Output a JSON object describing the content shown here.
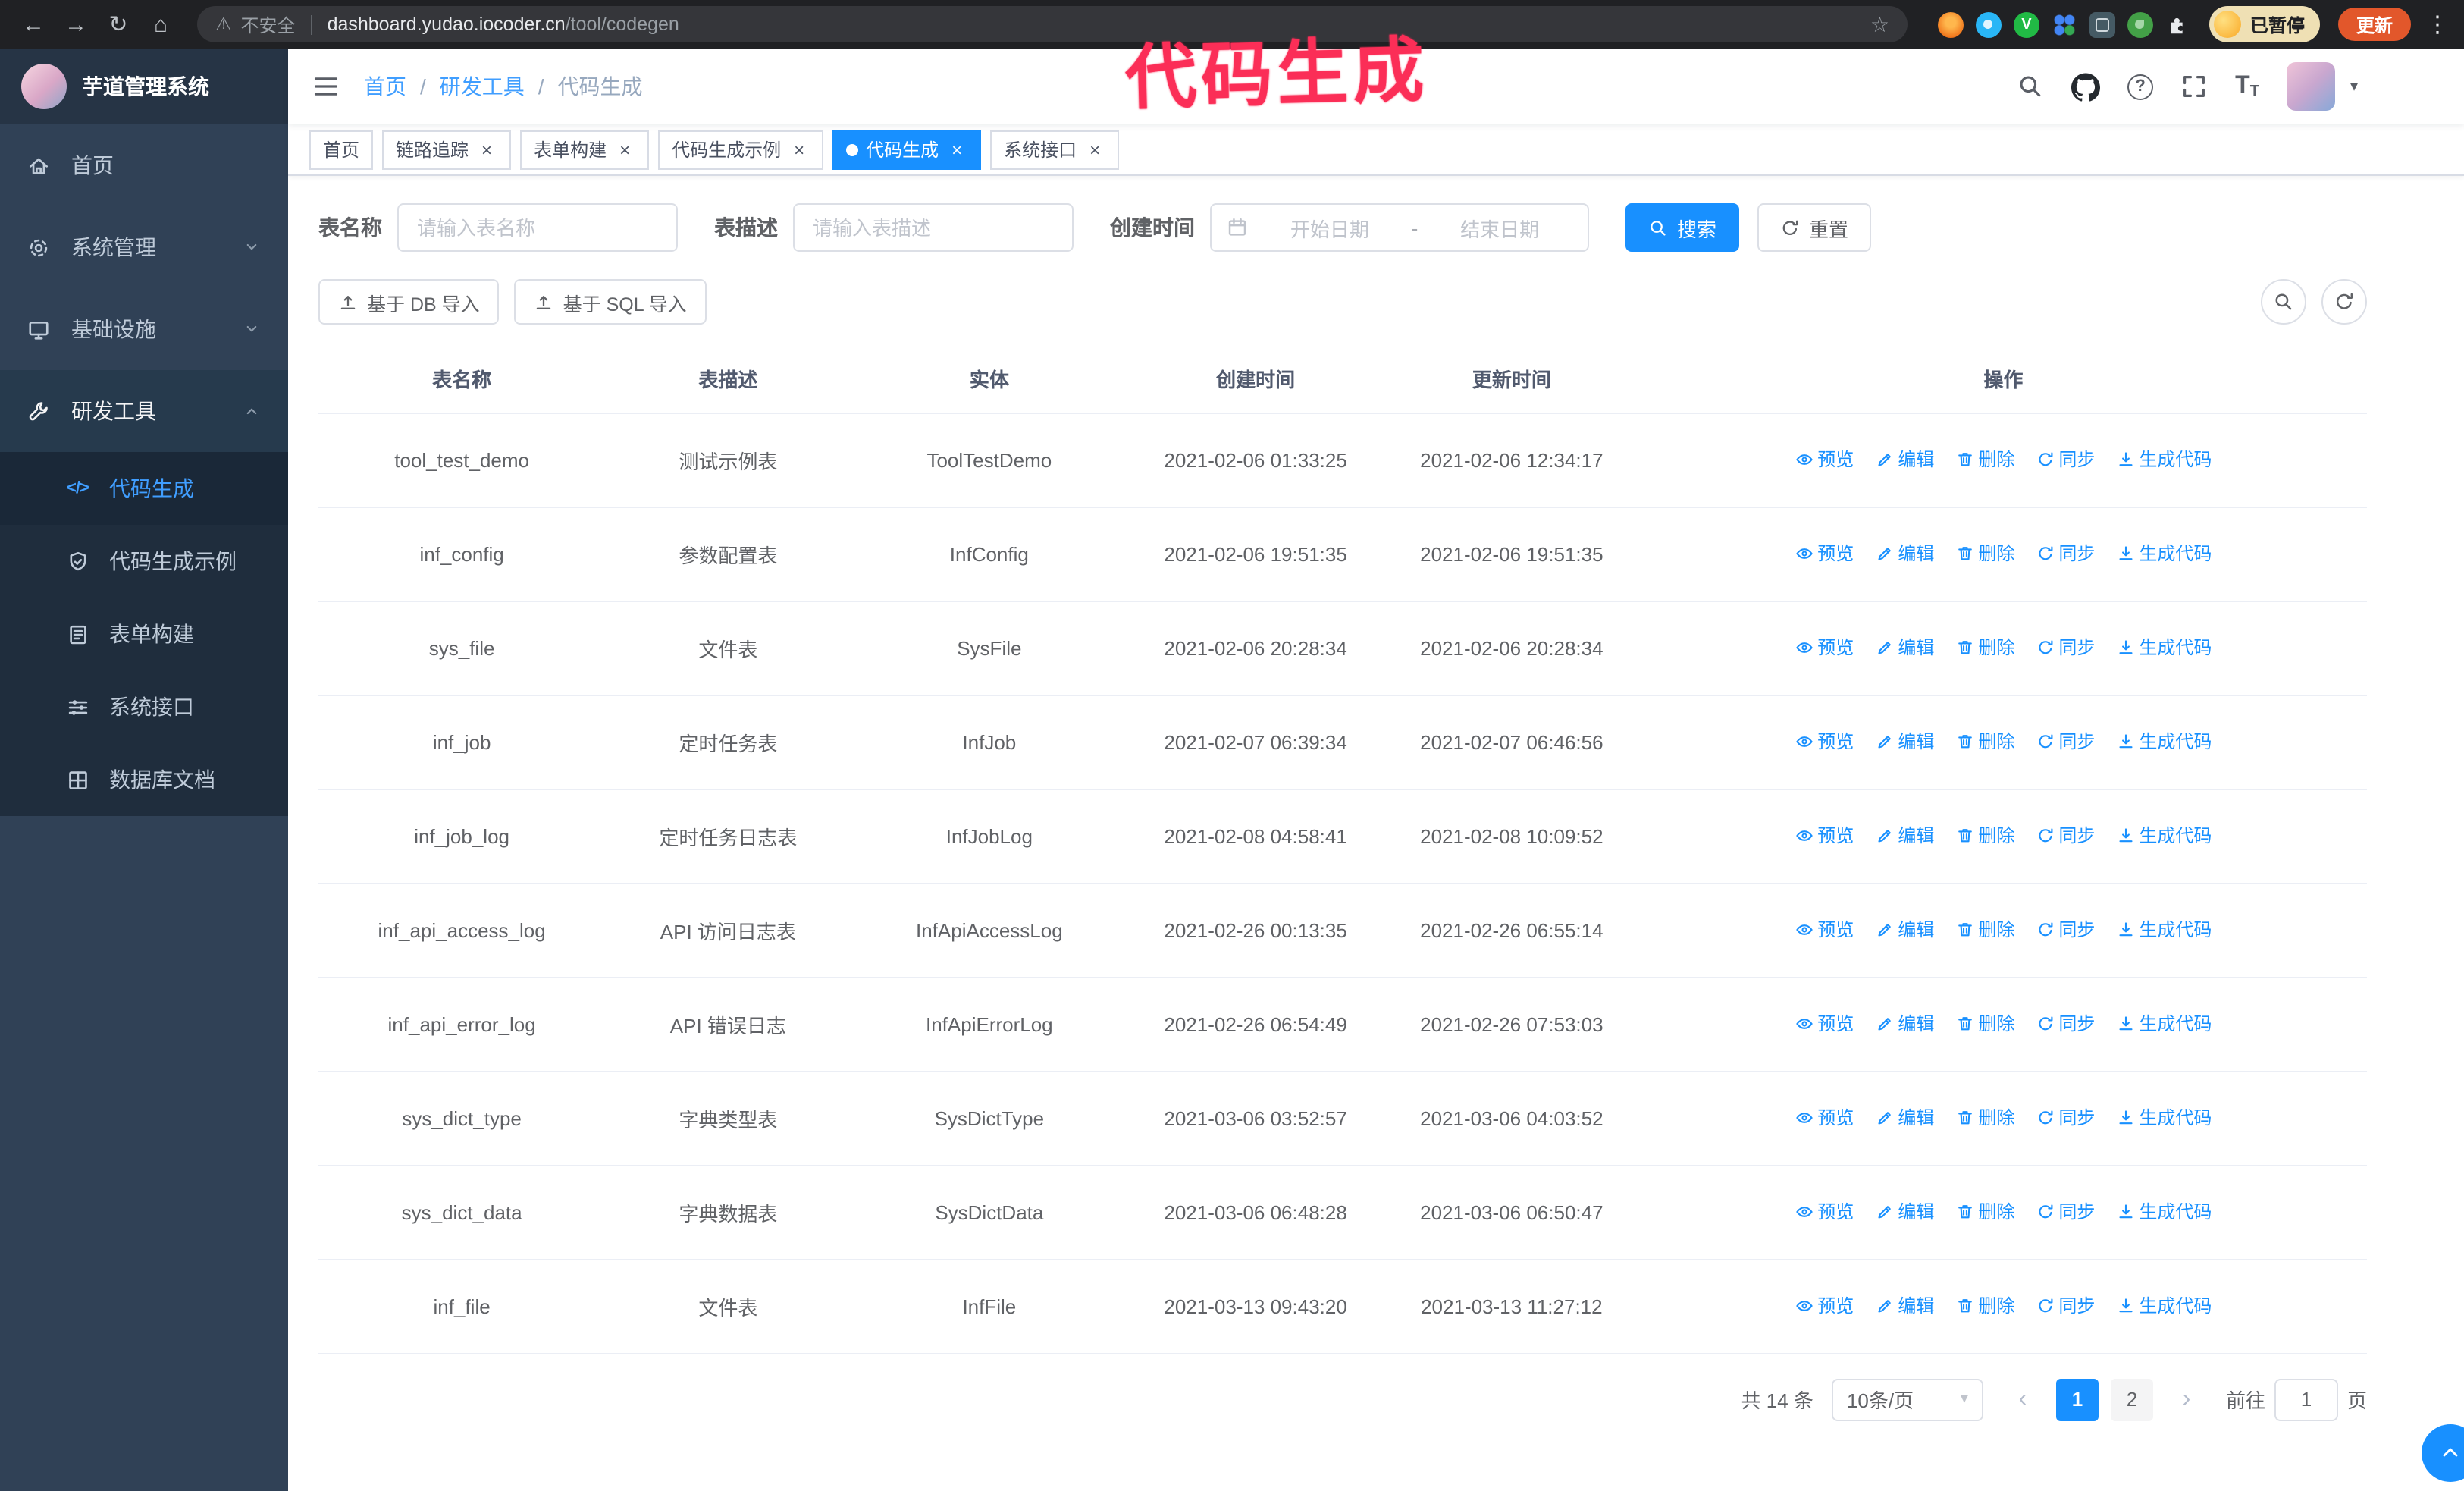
{
  "browser": {
    "security_label": "不安全",
    "url_host": "dashboard.yudao.iocoder.cn",
    "url_path": "/tool/codegen",
    "paused_label": "已暂停",
    "update_label": "更新",
    "nav_icons": [
      "back-icon",
      "forward-icon",
      "reload-icon",
      "home-icon"
    ],
    "right_icons": [
      "bookmark-star-icon",
      "extension-icons",
      "browser-menu-icon"
    ]
  },
  "annotation": {
    "text": "代码生成",
    "color": "#fb2e57"
  },
  "sidebar": {
    "logo_title": "芋道管理系统",
    "items": [
      {
        "label": "首页",
        "icon": "home",
        "expandable": false,
        "expanded": false
      },
      {
        "label": "系统管理",
        "icon": "gear",
        "expandable": true,
        "expanded": false
      },
      {
        "label": "基础设施",
        "icon": "monitor",
        "expandable": true,
        "expanded": false
      },
      {
        "label": "研发工具",
        "icon": "wrench",
        "expandable": true,
        "expanded": true
      }
    ],
    "submenu": [
      {
        "label": "代码生成",
        "icon": "code",
        "active": true
      },
      {
        "label": "代码生成示例",
        "icon": "shield",
        "active": false
      },
      {
        "label": "表单构建",
        "icon": "form",
        "active": false
      },
      {
        "label": "系统接口",
        "icon": "sliders",
        "active": false
      },
      {
        "label": "数据库文档",
        "icon": "grid",
        "active": false
      }
    ]
  },
  "header": {
    "breadcrumb": [
      "首页",
      "研发工具",
      "代码生成"
    ],
    "right_icons": [
      "search-icon",
      "github-icon",
      "help-icon",
      "fullscreen-icon",
      "font-size-icon",
      "avatar",
      "caret-down-icon"
    ]
  },
  "tabs": [
    {
      "label": "首页",
      "closable": false,
      "active": false
    },
    {
      "label": "链路追踪",
      "closable": true,
      "active": false
    },
    {
      "label": "表单构建",
      "closable": true,
      "active": false
    },
    {
      "label": "代码生成示例",
      "closable": true,
      "active": false
    },
    {
      "label": "代码生成",
      "closable": true,
      "active": true
    },
    {
      "label": "系统接口",
      "closable": true,
      "active": false
    }
  ],
  "filters": {
    "table_name_label": "表名称",
    "table_name_placeholder": "请输入表名称",
    "table_desc_label": "表描述",
    "table_desc_placeholder": "请输入表描述",
    "create_time_label": "创建时间",
    "date_start_placeholder": "开始日期",
    "date_separator": "-",
    "date_end_placeholder": "结束日期",
    "search_label": "搜索",
    "reset_label": "重置"
  },
  "toolbar": {
    "import_db_label": "基于 DB 导入",
    "import_sql_label": "基于 SQL 导入",
    "right_icons": [
      "search-icon",
      "refresh-icon"
    ]
  },
  "table": {
    "columns": [
      "表名称",
      "表描述",
      "实体",
      "创建时间",
      "更新时间",
      "操作"
    ],
    "actions": [
      {
        "label": "预览",
        "name": "preview",
        "icon": "eye"
      },
      {
        "label": "编辑",
        "name": "edit",
        "icon": "pencil"
      },
      {
        "label": "删除",
        "name": "delete",
        "icon": "trash"
      },
      {
        "label": "同步",
        "name": "sync",
        "icon": "refresh"
      },
      {
        "label": "生成代码",
        "name": "generate-code",
        "icon": "download"
      }
    ],
    "rows": [
      {
        "name": "tool_test_demo",
        "desc": "测试示例表",
        "entity": "ToolTestDemo",
        "created": "2021-02-06 01:33:25",
        "updated": "2021-02-06 12:34:17"
      },
      {
        "name": "inf_config",
        "desc": "参数配置表",
        "entity": "InfConfig",
        "created": "2021-02-06 19:51:35",
        "updated": "2021-02-06 19:51:35"
      },
      {
        "name": "sys_file",
        "desc": "文件表",
        "entity": "SysFile",
        "created": "2021-02-06 20:28:34",
        "updated": "2021-02-06 20:28:34"
      },
      {
        "name": "inf_job",
        "desc": "定时任务表",
        "entity": "InfJob",
        "created": "2021-02-07 06:39:34",
        "updated": "2021-02-07 06:46:56"
      },
      {
        "name": "inf_job_log",
        "desc": "定时任务日志表",
        "entity": "InfJobLog",
        "created": "2021-02-08 04:58:41",
        "updated": "2021-02-08 10:09:52"
      },
      {
        "name": "inf_api_access_log",
        "desc": "API 访问日志表",
        "entity": "InfApiAccessLog",
        "created": "2021-02-26 00:13:35",
        "updated": "2021-02-26 06:55:14"
      },
      {
        "name": "inf_api_error_log",
        "desc": "API 错误日志",
        "entity": "InfApiErrorLog",
        "created": "2021-02-26 06:54:49",
        "updated": "2021-02-26 07:53:03"
      },
      {
        "name": "sys_dict_type",
        "desc": "字典类型表",
        "entity": "SysDictType",
        "created": "2021-03-06 03:52:57",
        "updated": "2021-03-06 04:03:52"
      },
      {
        "name": "sys_dict_data",
        "desc": "字典数据表",
        "entity": "SysDictData",
        "created": "2021-03-06 06:48:28",
        "updated": "2021-03-06 06:50:47"
      },
      {
        "name": "inf_file",
        "desc": "文件表",
        "entity": "InfFile",
        "created": "2021-03-13 09:43:20",
        "updated": "2021-03-13 11:27:12"
      }
    ]
  },
  "pagination": {
    "total": "共 14 条",
    "page_size": "10条/页",
    "pages": [
      "1",
      "2"
    ],
    "active_page": "1",
    "goto_prefix": "前往",
    "goto_value": "1",
    "goto_suffix": "页"
  }
}
